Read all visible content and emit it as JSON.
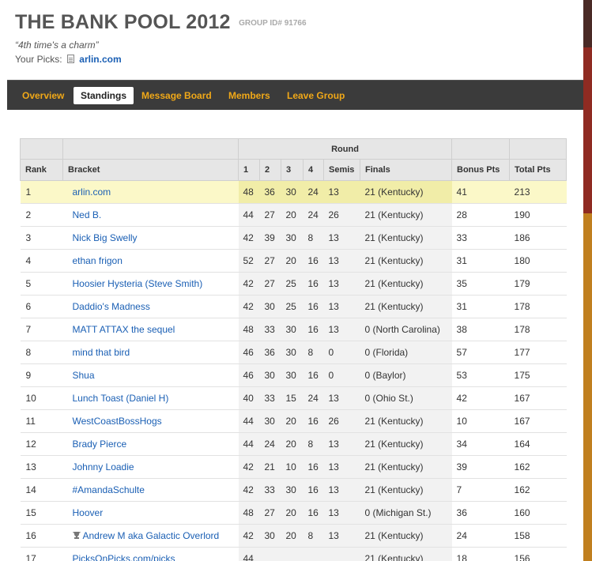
{
  "header": {
    "title": "THE BANK POOL 2012",
    "group_id": "GROUP ID# 91766",
    "motto": "“4th time's a charm”",
    "picks_label": "Your Picks:",
    "picks_link": "arlin.com"
  },
  "nav": {
    "tabs": [
      {
        "label": "Overview",
        "active": false
      },
      {
        "label": "Standings",
        "active": true
      },
      {
        "label": "Message Board",
        "active": false
      },
      {
        "label": "Members",
        "active": false
      },
      {
        "label": "Leave Group",
        "active": false
      }
    ]
  },
  "table": {
    "round_group_label": "Round",
    "columns": [
      "Rank",
      "Bracket",
      "1",
      "2",
      "3",
      "4",
      "Semis",
      "Finals",
      "Bonus Pts",
      "Total Pts"
    ],
    "rows": [
      [
        "1",
        "arlin.com",
        "48",
        "36",
        "30",
        "24",
        "13",
        "21 (Kentucky)",
        "41",
        "213"
      ],
      [
        "2",
        "Ned B.",
        "44",
        "27",
        "20",
        "24",
        "26",
        "21 (Kentucky)",
        "28",
        "190"
      ],
      [
        "3",
        "Nick Big Swelly",
        "42",
        "39",
        "30",
        "8",
        "13",
        "21 (Kentucky)",
        "33",
        "186"
      ],
      [
        "4",
        "ethan frigon",
        "52",
        "27",
        "20",
        "16",
        "13",
        "21 (Kentucky)",
        "31",
        "180"
      ],
      [
        "5",
        "Hoosier Hysteria (Steve Smith)",
        "42",
        "27",
        "25",
        "16",
        "13",
        "21 (Kentucky)",
        "35",
        "179"
      ],
      [
        "6",
        "Daddio's Madness",
        "42",
        "30",
        "25",
        "16",
        "13",
        "21 (Kentucky)",
        "31",
        "178"
      ],
      [
        "7",
        "MATT ATTAX the sequel",
        "48",
        "33",
        "30",
        "16",
        "13",
        "0 (North Carolina)",
        "38",
        "178"
      ],
      [
        "8",
        "mind that bird",
        "46",
        "36",
        "30",
        "8",
        "0",
        "0 (Florida)",
        "57",
        "177"
      ],
      [
        "9",
        "Shua",
        "46",
        "30",
        "30",
        "16",
        "0",
        "0 (Baylor)",
        "53",
        "175"
      ],
      [
        "10",
        "Lunch Toast (Daniel H)",
        "40",
        "33",
        "15",
        "24",
        "13",
        "0 (Ohio St.)",
        "42",
        "167"
      ],
      [
        "11",
        "WestCoastBossHogs",
        "44",
        "30",
        "20",
        "16",
        "26",
        "21 (Kentucky)",
        "10",
        "167"
      ],
      [
        "12",
        "Brady Pierce",
        "44",
        "24",
        "20",
        "8",
        "13",
        "21 (Kentucky)",
        "34",
        "164"
      ],
      [
        "13",
        "Johnny Loadie",
        "42",
        "21",
        "10",
        "16",
        "13",
        "21 (Kentucky)",
        "39",
        "162"
      ],
      [
        "14",
        "#AmandaSchulte",
        "42",
        "33",
        "30",
        "16",
        "13",
        "21 (Kentucky)",
        "7",
        "162"
      ],
      [
        "15",
        "Hoover",
        "48",
        "27",
        "20",
        "16",
        "13",
        "0 (Michigan St.)",
        "36",
        "160"
      ],
      [
        "16",
        "Andrew M aka Galactic Overlord",
        "42",
        "30",
        "20",
        "8",
        "13",
        "21 (Kentucky)",
        "24",
        "158"
      ],
      [
        "17",
        "PicksOnPicks.com/picks",
        "44",
        "",
        "",
        "",
        "",
        "21 (Kentucky)",
        "18",
        "156"
      ]
    ],
    "highlight_row": 0,
    "trophy_row": 15
  }
}
